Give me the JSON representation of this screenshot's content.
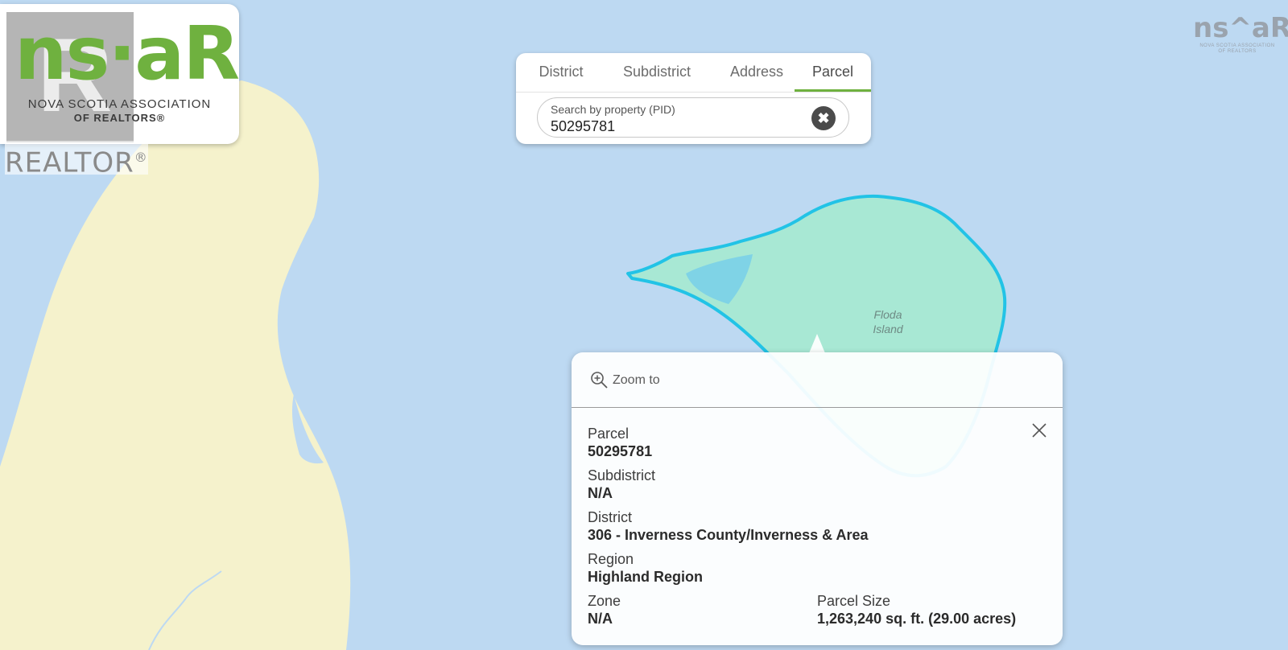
{
  "logo": {
    "mark": "ns·aR",
    "org_line1": "NOVA SCOTIA ASSOCIATION",
    "org_line2": "OF REALTORS®",
    "watermark_mark": "R",
    "watermark_text": "REALTOR",
    "watermark_reg": "®"
  },
  "corner_logo": {
    "mark": "ns^aR",
    "sub1": "NOVA SCOTIA ASSOCIATION",
    "sub2": "OF REALTORS"
  },
  "search": {
    "tabs": [
      {
        "label": "District",
        "active": false
      },
      {
        "label": "Subdistrict",
        "active": false
      },
      {
        "label": "Address",
        "active": false
      },
      {
        "label": "Parcel",
        "active": true
      }
    ],
    "field_label": "Search by property (PID)",
    "value": "50295781",
    "clear_icon": "x-circle-icon"
  },
  "map": {
    "island_label_line1": "Floda",
    "island_label_line2": "Island",
    "colors": {
      "water": "#bdd9f2",
      "land": "#f5f2cc",
      "parcel_fill": "#a8e8d4",
      "parcel_outline": "#22c3e6",
      "pond": "#7fd3e6"
    }
  },
  "popup": {
    "zoom_label": "Zoom to",
    "zoom_icon": "zoom-in-icon",
    "close_icon": "close-icon",
    "parcel_label": "Parcel",
    "parcel_value": "50295781",
    "subdistrict_label": "Subdistrict",
    "subdistrict_value": "N/A",
    "district_label": "District",
    "district_value": "306 - Inverness County/Inverness & Area",
    "region_label": "Region",
    "region_value": "Highland Region",
    "zone_label": "Zone",
    "zone_value": "N/A",
    "size_label": "Parcel Size",
    "size_value": "1,263,240 sq. ft. (29.00 acres)"
  }
}
